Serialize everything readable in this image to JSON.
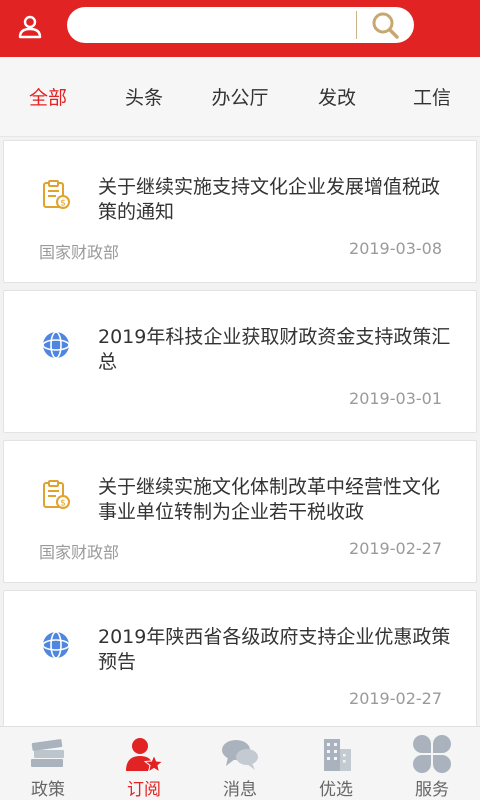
{
  "header": {
    "search": {
      "placeholder": ""
    },
    "user_icon": "user-icon",
    "search_icon": "search-icon"
  },
  "tabs": [
    {
      "label": "全部",
      "active": true
    },
    {
      "label": "头条",
      "active": false
    },
    {
      "label": "办公厅",
      "active": false
    },
    {
      "label": "发改",
      "active": false
    },
    {
      "label": "工信",
      "active": false
    }
  ],
  "articles": [
    {
      "icon": "tax-document-icon",
      "title": "关于继续实施支持文化企业发展增值税政策的通知",
      "source": "国家财政部",
      "date": "2019-03-08"
    },
    {
      "icon": "globe-icon",
      "title": "2019年科技企业获取财政资金支持政策汇总",
      "source": "",
      "date": "2019-03-01"
    },
    {
      "icon": "tax-document-icon",
      "title": "关于继续实施文化体制改革中经营性文化事业单位转制为企业若干税收政",
      "source": "国家财政部",
      "date": "2019-02-27"
    },
    {
      "icon": "globe-icon",
      "title": "2019年陕西省各级政府支持企业优惠政策预告",
      "source": "",
      "date": "2019-02-27"
    }
  ],
  "bottom_nav": [
    {
      "label": "政策",
      "icon": "books-icon",
      "active": false
    },
    {
      "label": "订阅",
      "icon": "subscribe-person-star-icon",
      "active": true
    },
    {
      "label": "消息",
      "icon": "chat-bubbles-icon",
      "active": false
    },
    {
      "label": "优选",
      "icon": "buildings-icon",
      "active": false
    },
    {
      "label": "服务",
      "icon": "grid-petals-icon",
      "active": false
    }
  ],
  "colors": {
    "brand_red": "#e22323",
    "gold": "#e0a32e",
    "globe_blue": "#4f86e0",
    "nav_gray": "#aab3bd"
  }
}
